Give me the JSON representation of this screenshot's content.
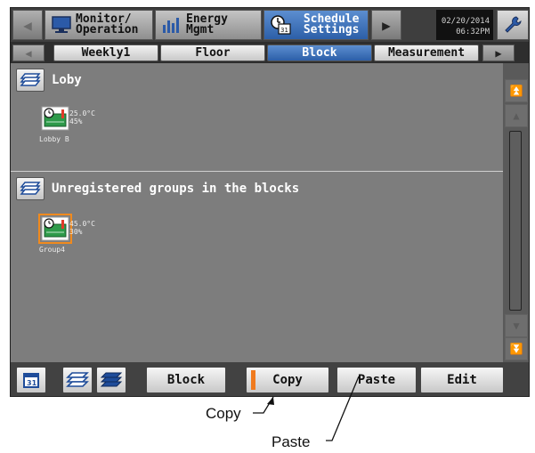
{
  "topbar": {
    "monitor_label": "Monitor/\nOperation",
    "energy_label": "Energy\nMgmt",
    "schedule_label": "Schedule\n Settings",
    "date": "02/20/2014",
    "time": "06:32PM"
  },
  "tabs": [
    "Weekly1",
    "Floor",
    "Block",
    "Measurement"
  ],
  "selected_tab": "Block",
  "blocks": [
    {
      "name": "Loby",
      "units": [
        {
          "name": "Lobby B",
          "temp": "25.0°C",
          "humidity": "45%",
          "selected": false
        }
      ]
    },
    {
      "name": "Unregistered groups in the blocks",
      "units": [
        {
          "name": "Group4",
          "temp": "45.0°C",
          "humidity": "30%",
          "selected": true
        }
      ]
    }
  ],
  "bottombar": {
    "block_label": "Block",
    "copy_label": "Copy",
    "paste_label": "Paste",
    "edit_label": "Edit"
  },
  "callouts": {
    "copy": "Copy",
    "paste": "Paste"
  },
  "colors": {
    "accent_blue": "#2c5fa8",
    "selection_orange": "#f08a1e",
    "panel_gray": "#7d7d7d"
  }
}
